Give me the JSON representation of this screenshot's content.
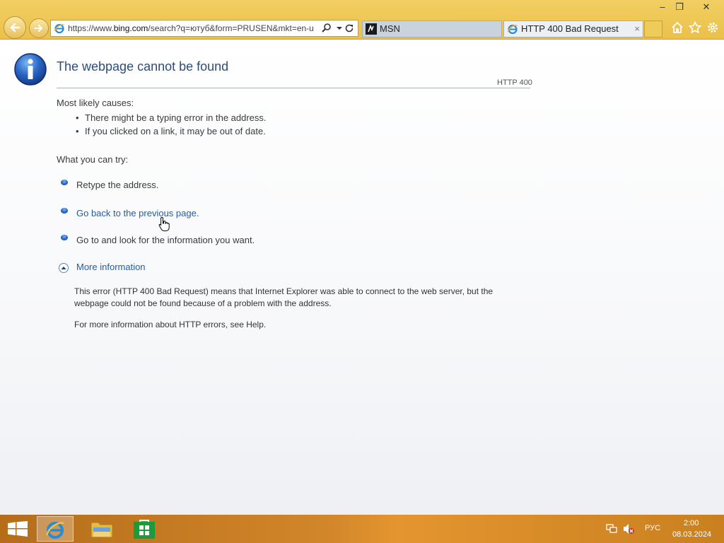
{
  "browser": {
    "url": "https://www.bing.com/search?q=ютуб&form=PRUSEN&mkt=en-u",
    "url_prefix": "https://www.",
    "url_domain": "bing.com",
    "url_rest": "/search?q=ютуб&form=PRUSEN&mkt=en-u",
    "tabs": [
      {
        "label": "MSN",
        "active": false
      },
      {
        "label": "HTTP 400 Bad Request",
        "active": true
      }
    ],
    "tab_close": "×",
    "window_controls": {
      "minimize": "–",
      "restore": "❐",
      "close": "✕"
    }
  },
  "page": {
    "title": "The webpage cannot be found",
    "code": "HTTP 400",
    "causes_heading": "Most likely causes:",
    "causes": [
      "There might be a typing error in the address.",
      "If you clicked on a link, it may be out of date."
    ],
    "try_heading": "What you can try:",
    "try_items": [
      "Retype the address.",
      "Go back to the previous page.",
      "Go to  and look for the information you want."
    ],
    "more_info": "More information",
    "details_1": "This error (HTTP 400 Bad Request) means that Internet Explorer was able to connect to the web server, but the",
    "details_2": "webpage could not be found because of a problem with the address.",
    "details_3": "For more information about HTTP errors, see Help."
  },
  "taskbar": {
    "language": "РУС",
    "time": "2:00",
    "date": "08.03.2024"
  },
  "colors": {
    "chrome": "#ebc04a",
    "title": "#2b4d7e",
    "link": "#1e5da8",
    "taskbar": "#d2862a"
  },
  "icons": [
    "back-arrow-icon",
    "forward-arrow-icon",
    "ie-icon",
    "search-icon",
    "dropdown-icon",
    "refresh-icon",
    "msn-icon",
    "home-icon",
    "favorites-star-icon",
    "settings-gear-icon",
    "info-icon",
    "blue-bullet-icon",
    "expand-icon",
    "windows-start-icon",
    "file-explorer-icon",
    "store-icon",
    "network-icon",
    "volume-muted-icon"
  ]
}
